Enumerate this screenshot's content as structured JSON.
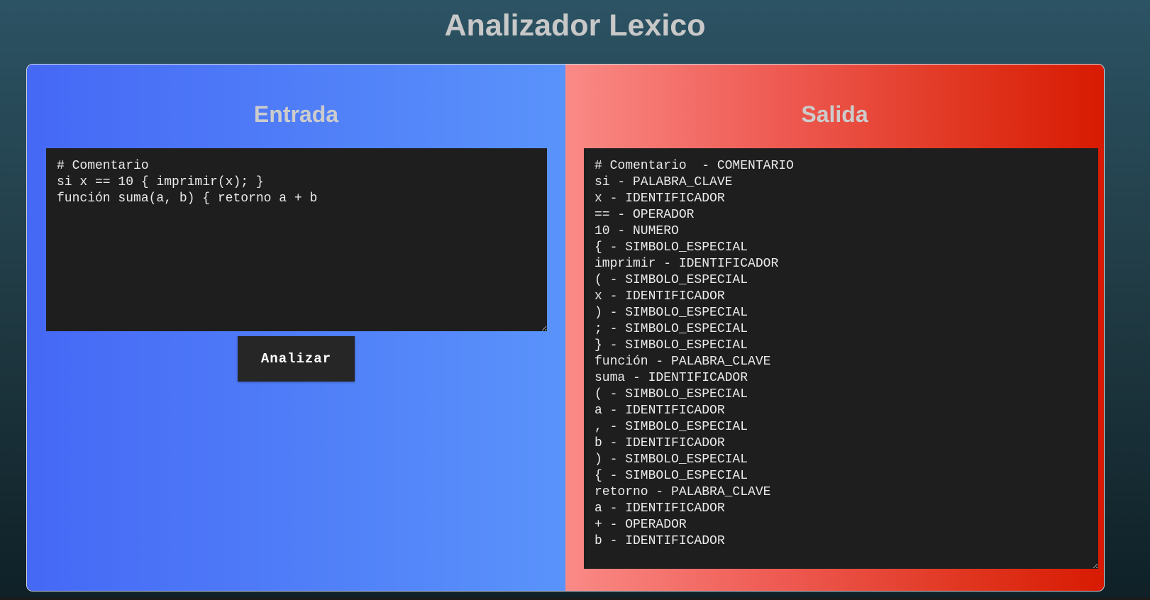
{
  "app": {
    "title": "Analizador Lexico"
  },
  "input_panel": {
    "title": "Entrada",
    "text": "# Comentario\nsi x == 10 { imprimir(x); }\nfunción suma(a, b) { retorno a + b",
    "button_label": "Analizar"
  },
  "output_panel": {
    "title": "Salida",
    "text": "# Comentario  - COMENTARIO\nsi - PALABRA_CLAVE\nx - IDENTIFICADOR\n== - OPERADOR\n10 - NUMERO\n{ - SIMBOLO_ESPECIAL\nimprimir - IDENTIFICADOR\n( - SIMBOLO_ESPECIAL\nx - IDENTIFICADOR\n) - SIMBOLO_ESPECIAL\n; - SIMBOLO_ESPECIAL\n} - SIMBOLO_ESPECIAL\nfunción - PALABRA_CLAVE\nsuma - IDENTIFICADOR\n( - SIMBOLO_ESPECIAL\na - IDENTIFICADOR\n, - SIMBOLO_ESPECIAL\nb - IDENTIFICADOR\n) - SIMBOLO_ESPECIAL\n{ - SIMBOLO_ESPECIAL\nretorno - PALABRA_CLAVE\na - IDENTIFICADOR\n+ - OPERADOR\nb - IDENTIFICADOR"
  },
  "colors": {
    "input_gradient_start": "#4568f5",
    "input_gradient_end": "#5a93fb",
    "output_gradient_start": "#fa8a86",
    "output_gradient_end": "#d81a02",
    "code_background": "#1e1e1e",
    "button_background": "#262626"
  }
}
